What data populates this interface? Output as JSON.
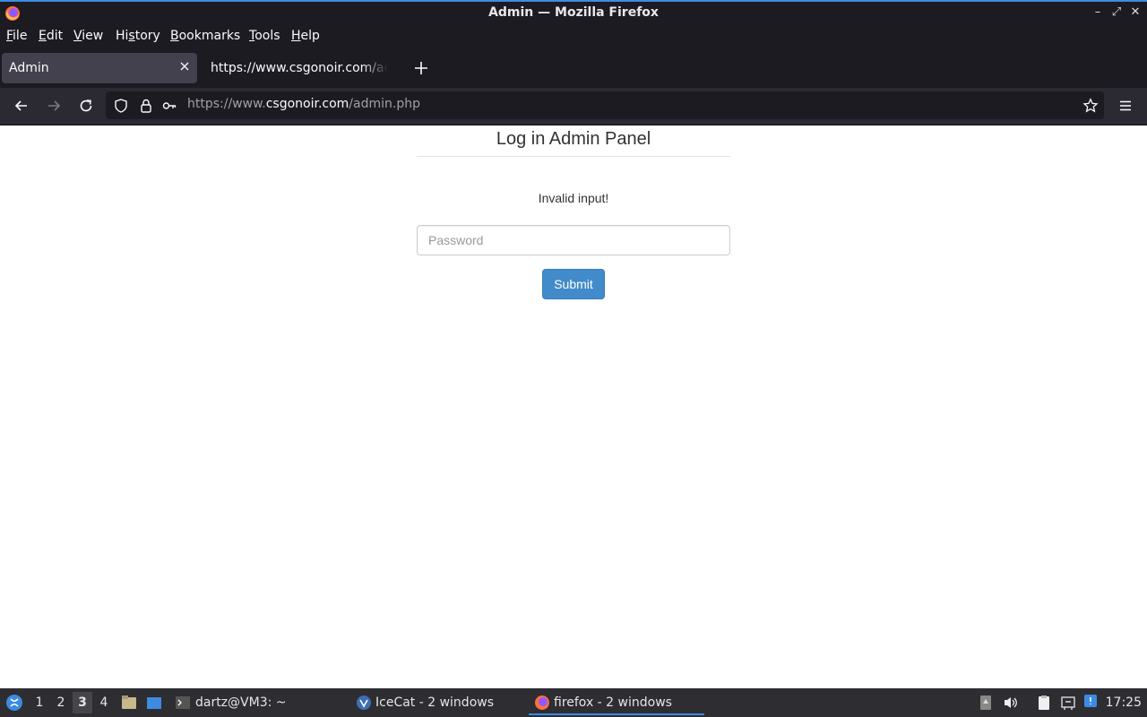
{
  "window": {
    "title": "Admin — Mozilla Firefox"
  },
  "menubar": {
    "items": [
      {
        "label": "File",
        "mnemonic": "F",
        "rest": "ile"
      },
      {
        "label": "Edit",
        "mnemonic": "E",
        "rest": "dit"
      },
      {
        "label": "View",
        "mnemonic": "V",
        "rest": "iew"
      },
      {
        "label": "History",
        "pre": "Hi",
        "mnemonic": "s",
        "rest": "tory"
      },
      {
        "label": "Bookmarks",
        "mnemonic": "B",
        "rest": "ookmarks"
      },
      {
        "label": "Tools",
        "mnemonic": "T",
        "rest": "ools"
      },
      {
        "label": "Help",
        "mnemonic": "H",
        "rest": "elp"
      }
    ]
  },
  "tabs": [
    {
      "label": "Admin",
      "active": true
    },
    {
      "label": "https://www.csgonoir.com/admin.php",
      "active": false
    }
  ],
  "urlbar": {
    "prefix": "https://www.",
    "host": "csgonoir.com",
    "path": "/admin.php"
  },
  "page": {
    "title": "Log in Admin Panel",
    "error": "Invalid input!",
    "password_placeholder": "Password",
    "password_value": "",
    "submit_label": "Submit"
  },
  "taskbar": {
    "workspaces": [
      "1",
      "2",
      "3",
      "4"
    ],
    "current_workspace": "3",
    "tasks": [
      {
        "label": "dartz@VM3: ~",
        "icon": "terminal-icon"
      },
      {
        "label": "IceCat - 2 windows",
        "icon": "icecat-icon"
      },
      {
        "label": "firefox - 2 windows",
        "icon": "firefox-icon",
        "active": true
      }
    ],
    "clock": "17:25"
  },
  "colors": {
    "chrome_dark": "#1c1b22",
    "toolbar": "#2b2a33",
    "active_tab": "#42414d",
    "submit_button": "#428bca",
    "accent": "#3d8be0",
    "taskbar": "#2d2d32"
  }
}
